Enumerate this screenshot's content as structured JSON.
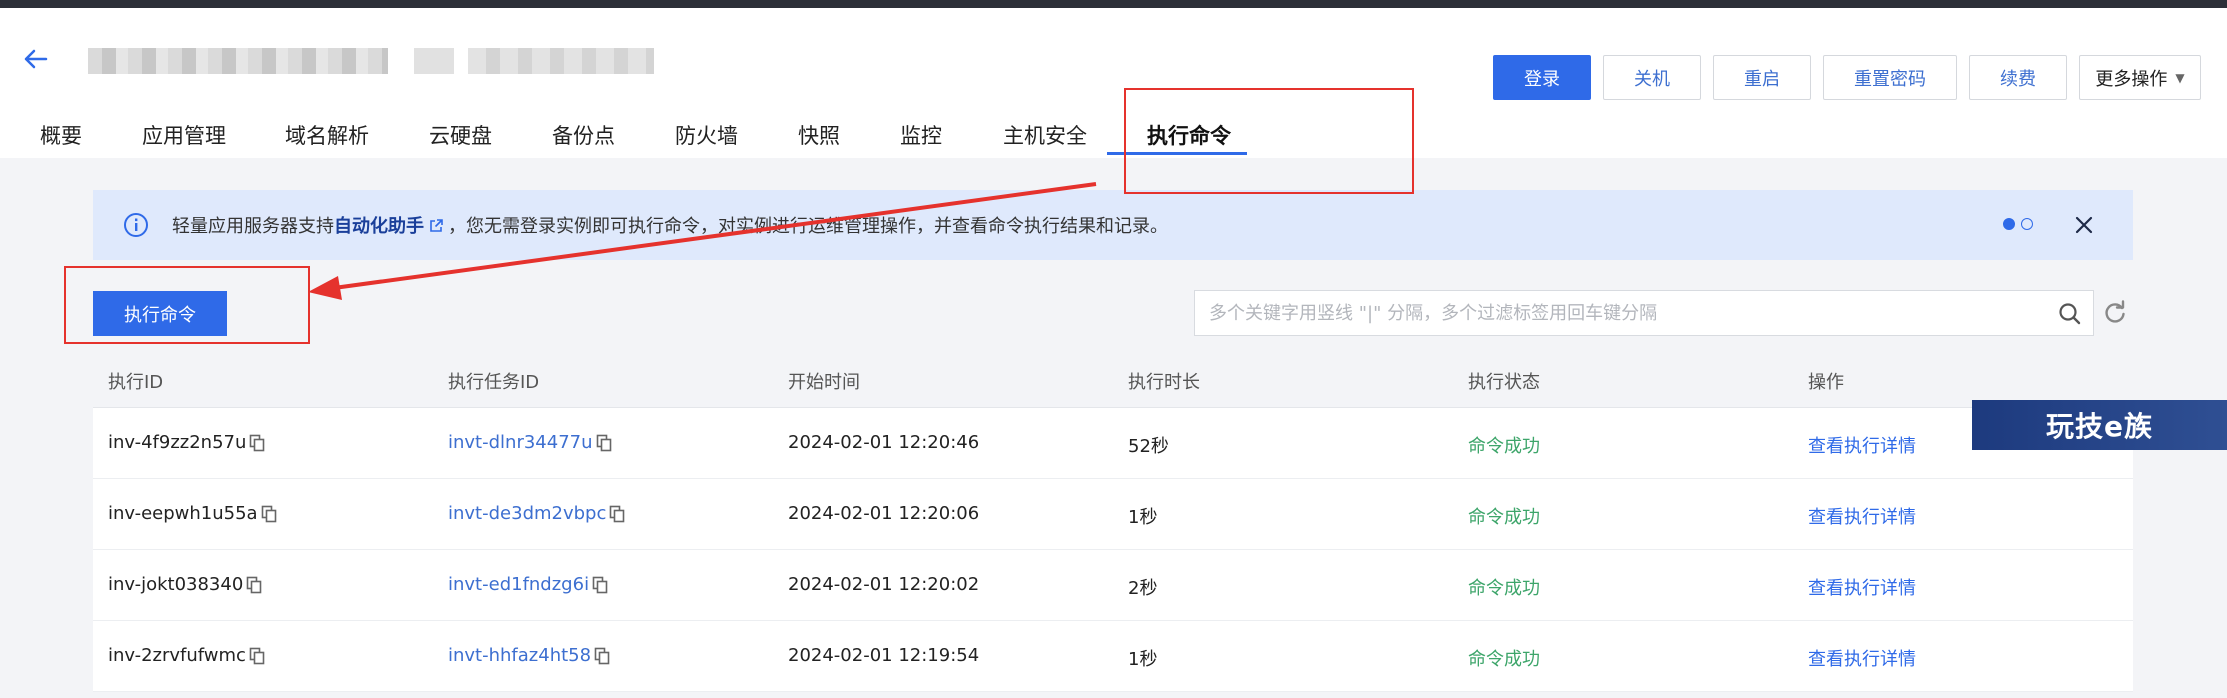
{
  "header": {
    "action_buttons": [
      {
        "label": "登录",
        "primary": true
      },
      {
        "label": "关机"
      },
      {
        "label": "重启"
      },
      {
        "label": "重置密码"
      },
      {
        "label": "续费"
      }
    ],
    "more_label": "更多操作"
  },
  "tabs": [
    {
      "label": "概要"
    },
    {
      "label": "应用管理"
    },
    {
      "label": "域名解析"
    },
    {
      "label": "云硬盘"
    },
    {
      "label": "备份点"
    },
    {
      "label": "防火墙"
    },
    {
      "label": "快照"
    },
    {
      "label": "监控"
    },
    {
      "label": "主机安全"
    },
    {
      "label": "执行命令",
      "active": true
    }
  ],
  "notice": {
    "text_before": "轻量应用服务器支持",
    "link": "自动化助手",
    "text_after": "，您无需登录实例即可执行命令，对实例进行运维管理操作，并查看命令执行结果和记录。"
  },
  "toolbar": {
    "execute_label": "执行命令",
    "search_placeholder": "多个关键字用竖线 \"|\" 分隔，多个过滤标签用回车键分隔"
  },
  "table": {
    "columns": [
      "执行ID",
      "执行任务ID",
      "开始时间",
      "执行时长",
      "执行状态",
      "操作"
    ],
    "rows": [
      {
        "id": "inv-4f9zz2n57u",
        "task_id": "invt-dlnr34477u",
        "start": "2024-02-01 12:20:46",
        "duration": "52秒",
        "status": "命令成功",
        "action": "查看执行详情"
      },
      {
        "id": "inv-eepwh1u55a",
        "task_id": "invt-de3dm2vbpc",
        "start": "2024-02-01 12:20:06",
        "duration": "1秒",
        "status": "命令成功",
        "action": "查看执行详情"
      },
      {
        "id": "inv-jokt038340",
        "task_id": "invt-ed1fndzg6i",
        "start": "2024-02-01 12:20:02",
        "duration": "2秒",
        "status": "命令成功",
        "action": "查看执行详情"
      },
      {
        "id": "inv-2zrvfufwmc",
        "task_id": "invt-hhfaz4ht58",
        "start": "2024-02-01 12:19:54",
        "duration": "1秒",
        "status": "命令成功",
        "action": "查看执行详情"
      }
    ]
  },
  "watermark": "玩技e族",
  "colors": {
    "primary": "#2f6ae8",
    "success": "#3da56a",
    "annotation_red": "#e5322d",
    "notice_bg": "#dfe9fc"
  }
}
